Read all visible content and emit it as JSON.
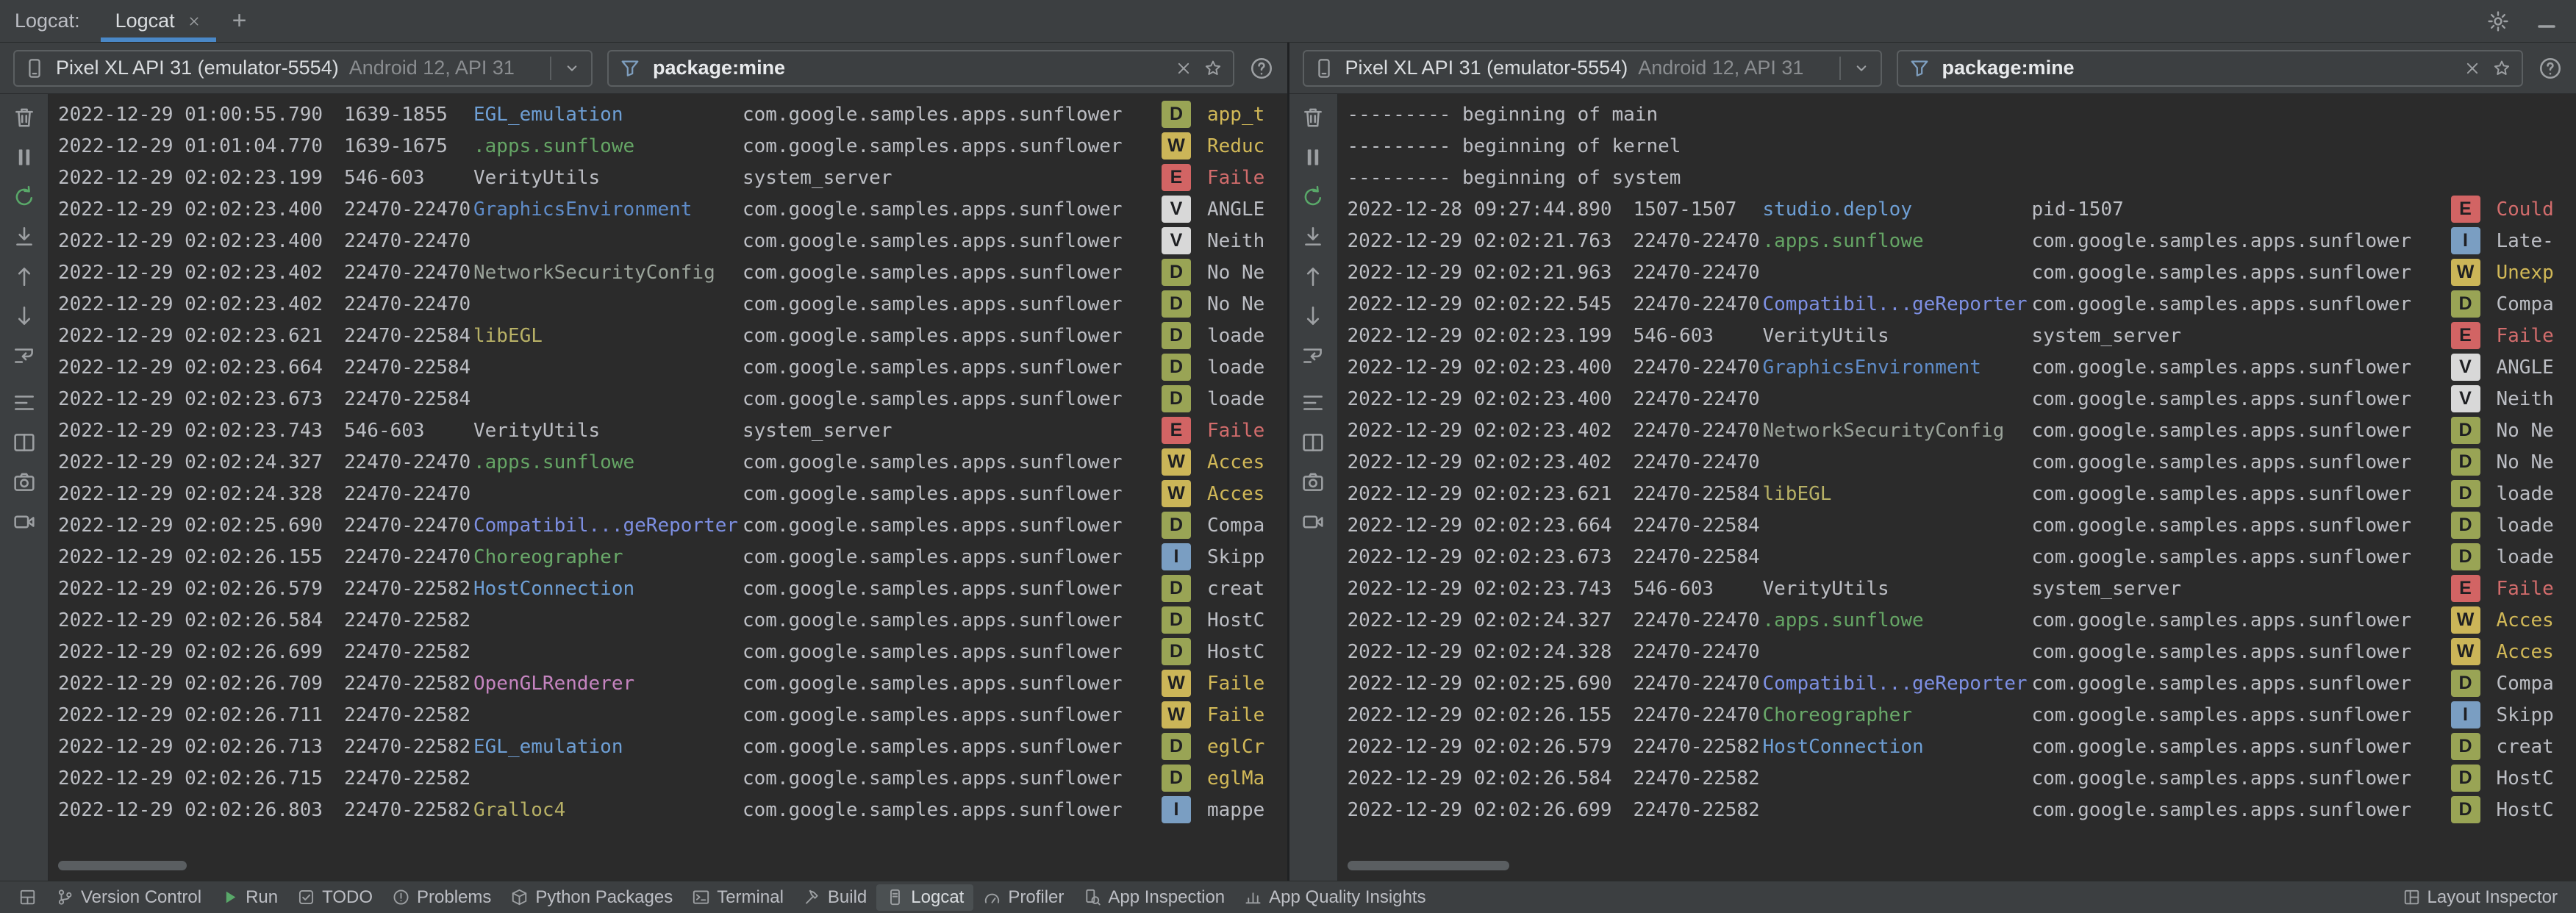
{
  "tab_bar": {
    "group_label": "Logcat:",
    "tab_label": "Logcat",
    "add_label": "+",
    "right_icons": [
      {
        "id": "settings",
        "icon": "settings"
      },
      {
        "id": "hide-toolwindow",
        "icon": "hide"
      }
    ]
  },
  "toolbar_icons": [
    {
      "id": "clear-logcat",
      "icon": "trash"
    },
    {
      "id": "pause-logcat",
      "icon": "pause"
    },
    {
      "id": "restart-logcat",
      "icon": "restart",
      "color": "#59A869"
    },
    {
      "id": "scroll-to-end",
      "icon": "scroll-end"
    },
    {
      "id": "previous-occurrence",
      "icon": "arrow-up"
    },
    {
      "id": "next-occurrence",
      "icon": "arrow-down"
    },
    {
      "id": "soft-wrap",
      "icon": "soft-wrap"
    },
    {
      "id": "configure-logcat-formatting",
      "icon": "configure"
    },
    {
      "id": "split-panels",
      "icon": "split"
    },
    {
      "id": "take-screenshot",
      "icon": "camera"
    },
    {
      "id": "record-screen",
      "icon": "video"
    }
  ],
  "panes": [
    {
      "device": {
        "name": "Pixel XL API 31 (emulator-5554)",
        "details": "Android 12, API 31"
      },
      "filter": {
        "value": "package:mine"
      },
      "scrollbar_width": 175,
      "logs": [
        {
          "t": "2022-12-29 01:00:55.790",
          "p": "1639-1855",
          "tag": "EGL_emulation",
          "pkg": "com.google.samples.apps.sunflower",
          "lvl": "D",
          "msg": "app_t",
          "tone": "warn"
        },
        {
          "t": "2022-12-29 01:01:04.770",
          "p": "1639-1675",
          "tag": ".apps.sunflowe",
          "pkg": "com.google.samples.apps.sunflower",
          "lvl": "W",
          "msg": "Reduc"
        },
        {
          "t": "2022-12-29 02:02:23.199",
          "p": "546-603",
          "tag": "VerityUtils",
          "pkg": "system_server",
          "lvl": "E",
          "msg": "Faile"
        },
        {
          "t": "2022-12-29 02:02:23.400",
          "p": "22470-22470",
          "tag": "GraphicsEnvironment",
          "pkg": "com.google.samples.apps.sunflower",
          "lvl": "V",
          "msg": "ANGLE"
        },
        {
          "t": "2022-12-29 02:02:23.400",
          "p": "22470-22470",
          "tag": "",
          "pkg": "com.google.samples.apps.sunflower",
          "lvl": "V",
          "msg": "Neith"
        },
        {
          "t": "2022-12-29 02:02:23.402",
          "p": "22470-22470",
          "tag": "NetworkSecurityConfig",
          "pkg": "com.google.samples.apps.sunflower",
          "lvl": "D",
          "msg": "No Ne"
        },
        {
          "t": "2022-12-29 02:02:23.402",
          "p": "22470-22470",
          "tag": "",
          "pkg": "com.google.samples.apps.sunflower",
          "lvl": "D",
          "msg": "No Ne"
        },
        {
          "t": "2022-12-29 02:02:23.621",
          "p": "22470-22584",
          "tag": "libEGL",
          "pkg": "com.google.samples.apps.sunflower",
          "lvl": "D",
          "msg": "loade"
        },
        {
          "t": "2022-12-29 02:02:23.664",
          "p": "22470-22584",
          "tag": "",
          "pkg": "com.google.samples.apps.sunflower",
          "lvl": "D",
          "msg": "loade"
        },
        {
          "t": "2022-12-29 02:02:23.673",
          "p": "22470-22584",
          "tag": "",
          "pkg": "com.google.samples.apps.sunflower",
          "lvl": "D",
          "msg": "loade"
        },
        {
          "t": "2022-12-29 02:02:23.743",
          "p": "546-603",
          "tag": "VerityUtils",
          "pkg": "system_server",
          "lvl": "E",
          "msg": "Faile"
        },
        {
          "t": "2022-12-29 02:02:24.327",
          "p": "22470-22470",
          "tag": ".apps.sunflowe",
          "pkg": "com.google.samples.apps.sunflower",
          "lvl": "W",
          "msg": "Acces"
        },
        {
          "t": "2022-12-29 02:02:24.328",
          "p": "22470-22470",
          "tag": "",
          "pkg": "com.google.samples.apps.sunflower",
          "lvl": "W",
          "msg": "Acces"
        },
        {
          "t": "2022-12-29 02:02:25.690",
          "p": "22470-22470",
          "tag": "Compatibil...geReporter",
          "pkg": "com.google.samples.apps.sunflower",
          "lvl": "D",
          "msg": "Compa"
        },
        {
          "t": "2022-12-29 02:02:26.155",
          "p": "22470-22470",
          "tag": "Choreographer",
          "pkg": "com.google.samples.apps.sunflower",
          "lvl": "I",
          "msg": "Skipp"
        },
        {
          "t": "2022-12-29 02:02:26.579",
          "p": "22470-22582",
          "tag": "HostConnection",
          "pkg": "com.google.samples.apps.sunflower",
          "lvl": "D",
          "msg": "creat"
        },
        {
          "t": "2022-12-29 02:02:26.584",
          "p": "22470-22582",
          "tag": "",
          "pkg": "com.google.samples.apps.sunflower",
          "lvl": "D",
          "msg": "HostC"
        },
        {
          "t": "2022-12-29 02:02:26.699",
          "p": "22470-22582",
          "tag": "",
          "pkg": "com.google.samples.apps.sunflower",
          "lvl": "D",
          "msg": "HostC"
        },
        {
          "t": "2022-12-29 02:02:26.709",
          "p": "22470-22582",
          "tag": "OpenGLRenderer",
          "pkg": "com.google.samples.apps.sunflower",
          "lvl": "W",
          "msg": "Faile"
        },
        {
          "t": "2022-12-29 02:02:26.711",
          "p": "22470-22582",
          "tag": "",
          "pkg": "com.google.samples.apps.sunflower",
          "lvl": "W",
          "msg": "Faile"
        },
        {
          "t": "2022-12-29 02:02:26.713",
          "p": "22470-22582",
          "tag": "EGL_emulation",
          "pkg": "com.google.samples.apps.sunflower",
          "lvl": "D",
          "msg": "eglCr",
          "tone": "warn"
        },
        {
          "t": "2022-12-29 02:02:26.715",
          "p": "22470-22582",
          "tag": "",
          "pkg": "com.google.samples.apps.sunflower",
          "lvl": "D",
          "msg": "eglMa",
          "tone": "warn"
        },
        {
          "t": "2022-12-29 02:02:26.803",
          "p": "22470-22582",
          "tag": "Gralloc4",
          "pkg": "com.google.samples.apps.sunflower",
          "lvl": "I",
          "msg": "mappe"
        }
      ]
    },
    {
      "device": {
        "name": "Pixel XL API 31 (emulator-5554)",
        "details": "Android 12, API 31"
      },
      "filter": {
        "value": "package:mine"
      },
      "scrollbar_width": 220,
      "logs": [
        {
          "raw": "--------- beginning of main"
        },
        {
          "raw": "--------- beginning of kernel"
        },
        {
          "raw": "--------- beginning of system"
        },
        {
          "t": "2022-12-28 09:27:44.890",
          "p": "1507-1507",
          "tag": "studio.deploy",
          "pkg": "pid-1507",
          "lvl": "E",
          "msg": "Could"
        },
        {
          "t": "2022-12-29 02:02:21.763",
          "p": "22470-22470",
          "tag": ".apps.sunflowe",
          "pkg": "com.google.samples.apps.sunflower",
          "lvl": "I",
          "msg": "Late-"
        },
        {
          "t": "2022-12-29 02:02:21.963",
          "p": "22470-22470",
          "tag": "",
          "pkg": "com.google.samples.apps.sunflower",
          "lvl": "W",
          "msg": "Unexp"
        },
        {
          "t": "2022-12-29 02:02:22.545",
          "p": "22470-22470",
          "tag": "Compatibil...geReporter",
          "pkg": "com.google.samples.apps.sunflower",
          "lvl": "D",
          "msg": "Compa"
        },
        {
          "t": "2022-12-29 02:02:23.199",
          "p": "546-603",
          "tag": "VerityUtils",
          "pkg": "system_server",
          "lvl": "E",
          "msg": "Faile"
        },
        {
          "t": "2022-12-29 02:02:23.400",
          "p": "22470-22470",
          "tag": "GraphicsEnvironment",
          "pkg": "com.google.samples.apps.sunflower",
          "lvl": "V",
          "msg": "ANGLE"
        },
        {
          "t": "2022-12-29 02:02:23.400",
          "p": "22470-22470",
          "tag": "",
          "pkg": "com.google.samples.apps.sunflower",
          "lvl": "V",
          "msg": "Neith"
        },
        {
          "t": "2022-12-29 02:02:23.402",
          "p": "22470-22470",
          "tag": "NetworkSecurityConfig",
          "pkg": "com.google.samples.apps.sunflower",
          "lvl": "D",
          "msg": "No Ne"
        },
        {
          "t": "2022-12-29 02:02:23.402",
          "p": "22470-22470",
          "tag": "",
          "pkg": "com.google.samples.apps.sunflower",
          "lvl": "D",
          "msg": "No Ne"
        },
        {
          "t": "2022-12-29 02:02:23.621",
          "p": "22470-22584",
          "tag": "libEGL",
          "pkg": "com.google.samples.apps.sunflower",
          "lvl": "D",
          "msg": "loade"
        },
        {
          "t": "2022-12-29 02:02:23.664",
          "p": "22470-22584",
          "tag": "",
          "pkg": "com.google.samples.apps.sunflower",
          "lvl": "D",
          "msg": "loade"
        },
        {
          "t": "2022-12-29 02:02:23.673",
          "p": "22470-22584",
          "tag": "",
          "pkg": "com.google.samples.apps.sunflower",
          "lvl": "D",
          "msg": "loade"
        },
        {
          "t": "2022-12-29 02:02:23.743",
          "p": "546-603",
          "tag": "VerityUtils",
          "pkg": "system_server",
          "lvl": "E",
          "msg": "Faile"
        },
        {
          "t": "2022-12-29 02:02:24.327",
          "p": "22470-22470",
          "tag": ".apps.sunflowe",
          "pkg": "com.google.samples.apps.sunflower",
          "lvl": "W",
          "msg": "Acces"
        },
        {
          "t": "2022-12-29 02:02:24.328",
          "p": "22470-22470",
          "tag": "",
          "pkg": "com.google.samples.apps.sunflower",
          "lvl": "W",
          "msg": "Acces"
        },
        {
          "t": "2022-12-29 02:02:25.690",
          "p": "22470-22470",
          "tag": "Compatibil...geReporter",
          "pkg": "com.google.samples.apps.sunflower",
          "lvl": "D",
          "msg": "Compa"
        },
        {
          "t": "2022-12-29 02:02:26.155",
          "p": "22470-22470",
          "tag": "Choreographer",
          "pkg": "com.google.samples.apps.sunflower",
          "lvl": "I",
          "msg": "Skipp"
        },
        {
          "t": "2022-12-29 02:02:26.579",
          "p": "22470-22582",
          "tag": "HostConnection",
          "pkg": "com.google.samples.apps.sunflower",
          "lvl": "D",
          "msg": "creat"
        },
        {
          "t": "2022-12-29 02:02:26.584",
          "p": "22470-22582",
          "tag": "",
          "pkg": "com.google.samples.apps.sunflower",
          "lvl": "D",
          "msg": "HostC"
        },
        {
          "t": "2022-12-29 02:02:26.699",
          "p": "22470-22582",
          "tag": "",
          "pkg": "com.google.samples.apps.sunflower",
          "lvl": "D",
          "msg": "HostC"
        }
      ]
    }
  ],
  "status_bar": {
    "left": [
      {
        "id": "tool-window-switcher",
        "icon": "grid",
        "label": ""
      },
      {
        "id": "version-control",
        "icon": "branch",
        "label": "Version Control"
      },
      {
        "id": "run",
        "icon": "play",
        "label": "Run",
        "icon_color": "#59A869"
      },
      {
        "id": "todo",
        "icon": "todo",
        "label": "TODO"
      },
      {
        "id": "problems",
        "icon": "problems",
        "label": "Problems"
      },
      {
        "id": "python-packages",
        "icon": "package",
        "label": "Python Packages"
      },
      {
        "id": "terminal",
        "icon": "terminal",
        "label": "Terminal"
      },
      {
        "id": "build",
        "icon": "hammer",
        "label": "Build"
      },
      {
        "id": "logcat",
        "icon": "logcat-device",
        "label": "Logcat",
        "active": true
      },
      {
        "id": "profiler",
        "icon": "profiler",
        "label": "Profiler"
      },
      {
        "id": "app-inspection",
        "icon": "inspect",
        "label": "App Inspection"
      },
      {
        "id": "app-quality-insights",
        "icon": "insights",
        "label": "App Quality Insights"
      }
    ],
    "right": [
      {
        "id": "layout-inspector",
        "icon": "layout",
        "label": "Layout Inspector"
      }
    ]
  },
  "colors": {
    "bg": "#2b2b2b",
    "chrome": "#3c3f41",
    "border": "#323232",
    "text": "#bcbec4",
    "dim": "#8a8d90",
    "accent": "#4a88c7",
    "icon": "#9da0a3",
    "tags": {
      "EGL_emulation": "#6e9fd5",
      ".apps.sunflowe": "#65a565",
      "VerityUtils": "#bcbec4",
      "GraphicsEnvironment": "#5f8cc9",
      "NetworkSecurityConfig": "#9aa39a",
      "libEGL": "#b8b166",
      "Compatibil...geReporter": "#7d8fe2",
      "Choreographer": "#69a869",
      "HostConnection": "#6e9fd5",
      "OpenGLRenderer": "#c584c0",
      "Gralloc4": "#b8b166",
      "studio.deploy": "#6e9fd5"
    },
    "levels": {
      "V": {
        "bg": "#d8d8d8",
        "fg": "#1e1f22"
      },
      "D": {
        "bg": "#99a455",
        "fg": "#1e1f22"
      },
      "I": {
        "bg": "#7a9ec2",
        "fg": "#1e1f22"
      },
      "W": {
        "bg": "#cbb558",
        "fg": "#1e1f22"
      },
      "E": {
        "bg": "#d26464",
        "fg": "#1e1f22"
      }
    },
    "msg": {
      "default": "#bcbec4",
      "warn": "#d1b857",
      "error": "#d26c6c"
    }
  }
}
